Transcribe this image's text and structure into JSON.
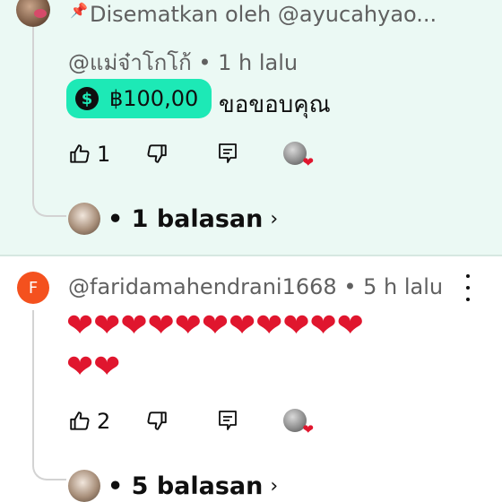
{
  "pinned_comment": {
    "pinned_by": "Disematkan oleh @ayucahyao...",
    "handle": "@แม่จ๋าโกโก้",
    "time": "• 1 h lalu",
    "super_thanks_amount": "฿100,00",
    "super_thanks_icon": "dollar-heart-icon",
    "message": "ขอขอบคุณ",
    "likes": "1",
    "replies": "• 1 balasan",
    "colors": {
      "background": "#ebf9f4",
      "super_thanks": "#1de9b6"
    }
  },
  "comment": {
    "avatar_letter": "F",
    "avatar_color": "#f4511e",
    "handle": "@faridamahendrani1668",
    "time": "• 5 h lalu",
    "message_line1": "❤❤❤❤❤❤❤❤❤❤❤",
    "message_line2": "❤❤",
    "likes": "2",
    "replies": "• 5 balasan"
  }
}
